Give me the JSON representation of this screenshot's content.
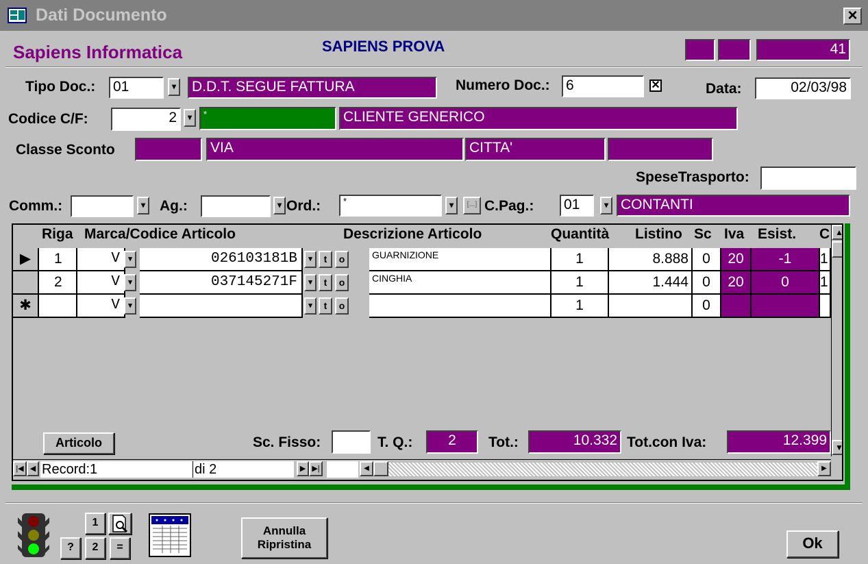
{
  "window": {
    "title": "Dati Documento",
    "close_label": "×"
  },
  "header": {
    "company": "Sapiens Informatica",
    "doc_name": "SAPIENS PROVA",
    "counter": "41"
  },
  "form": {
    "tipo_doc_label": "Tipo Doc.:",
    "tipo_doc_value": "01",
    "tipo_doc_desc": "D.D.T. SEGUE FATTURA",
    "numero_doc_label": "Numero Doc.:",
    "numero_doc_value": "6",
    "check_mark": "✕",
    "data_label": "Data:",
    "data_value": "02/03/98",
    "codice_label": "Codice C/F:",
    "codice_value": "2",
    "codice_code": "*",
    "cliente": "CLIENTE GENERICO",
    "classe_sconto_label": "Classe Sconto",
    "via": "VIA",
    "citta": "CITTA'",
    "spese_label": "SpeseTrasporto:",
    "comm_label": "Comm.:",
    "ag_label": "Ag.:",
    "ord_label": "Ord.:",
    "ord_value": "*",
    "cpag_label": "C.Pag.:",
    "cpag_value": "01",
    "cpag_desc": "CONTANTI"
  },
  "grid": {
    "headers": [
      "Riga",
      "Marca/Codice Articolo",
      "Descrizione Articolo",
      "Quantità",
      "Listino",
      "Sc",
      "Iva",
      "Esist.",
      "C"
    ],
    "rows": [
      {
        "selector": "▶",
        "riga": "1",
        "marca": "V",
        "codice": "026103181B",
        "descrizione": "GUARNIZIONE",
        "quantita": "1",
        "listino": "8.888",
        "sc": "0",
        "iva": "20",
        "esist": "-1",
        "c": "1"
      },
      {
        "selector": "",
        "riga": "2",
        "marca": "V",
        "codice": "037145271F",
        "descrizione": "CINGHIA",
        "quantita": "1",
        "listino": "1.444",
        "sc": "0",
        "iva": "20",
        "esist": "0",
        "c": "1"
      },
      {
        "selector": "✱",
        "riga": "",
        "marca": "V",
        "codice": "",
        "descrizione": "",
        "quantita": "1",
        "listino": "",
        "sc": "0",
        "iva": "",
        "esist": "",
        "c": ""
      }
    ],
    "mini_t": "t",
    "mini_o": "o"
  },
  "footer": {
    "articolo_button": "Articolo",
    "sc_fisso_label": "Sc. Fisso:",
    "tq_label": "T. Q.:",
    "tq_value": "2",
    "tot_label": "Tot.:",
    "tot_value": "10.332",
    "tot_iva_label": "Tot.con Iva:",
    "tot_iva_value": "12.399"
  },
  "nav": {
    "record_label": "Record:",
    "record_value": "1",
    "of_label": "di 2"
  },
  "bottom": {
    "btn_1": "1",
    "btn_2": "2",
    "btn_help": "?",
    "btn_eq": "=",
    "annulla_line1": "Annulla",
    "annulla_line2": "Ripristina",
    "ok_button": "Ok"
  }
}
